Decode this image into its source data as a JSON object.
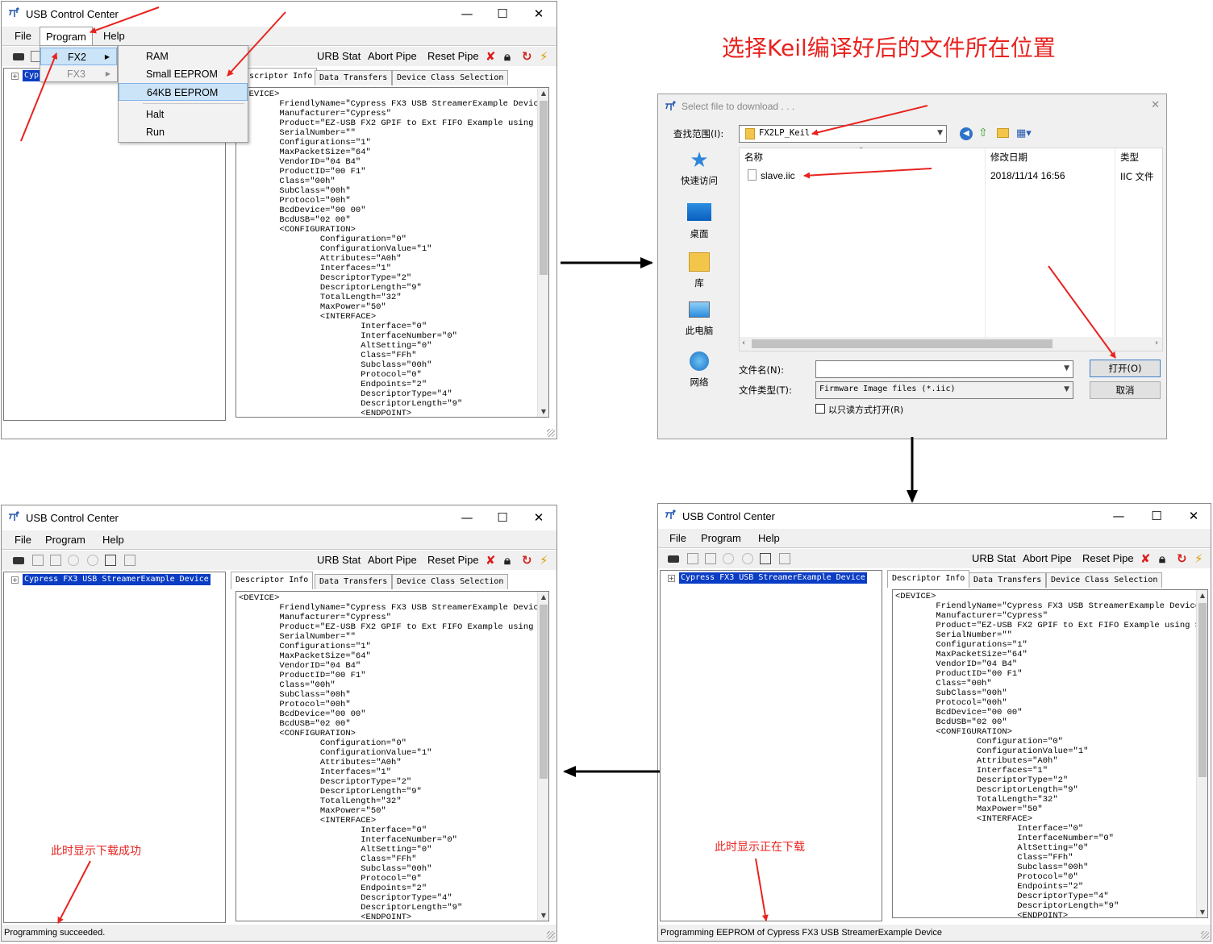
{
  "heading": "选择Keil编译好后的文件所在位置",
  "app_title": "USB Control Center",
  "window_controls": {
    "minimize": "—",
    "maximize": "☐",
    "close": "✕"
  },
  "menu": {
    "file": "File",
    "program": "Program",
    "help": "Help"
  },
  "toolbar": {
    "urb_stat": "URB Stat",
    "abort_pipe": "Abort Pipe",
    "reset_pipe": "Reset Pipe"
  },
  "tabs": {
    "descriptor_info": "Descriptor Info",
    "descriptor_info_clipped": "scriptor Info",
    "data_transfers": "Data Transfers",
    "device_class_selection": "Device Class Selection"
  },
  "tree": {
    "device": "Cypress FX3 USB StreamerExample Device",
    "device_clipped": "Cyp"
  },
  "descriptor_text": "<DEVICE>\n        FriendlyName=\"Cypress FX3 USB StreamerExample Device\"\n        Manufacturer=\"Cypress\"\n        Product=\"EZ-USB FX2 GPIF to Ext FIFO Example using Sir\n        SerialNumber=\"\"\n        Configurations=\"1\"\n        MaxPacketSize=\"64\"\n        VendorID=\"04 B4\"\n        ProductID=\"00 F1\"\n        Class=\"00h\"\n        SubClass=\"00h\"\n        Protocol=\"00h\"\n        BcdDevice=\"00 00\"\n        BcdUSB=\"02 00\"\n        <CONFIGURATION>\n                Configuration=\"0\"\n                ConfigurationValue=\"1\"\n                Attributes=\"A0h\"\n                Interfaces=\"1\"\n                DescriptorType=\"2\"\n                DescriptorLength=\"9\"\n                TotalLength=\"32\"\n                MaxPower=\"50\"\n                <INTERFACE>\n                        Interface=\"0\"\n                        InterfaceNumber=\"0\"\n                        AltSetting=\"0\"\n                        Class=\"FFh\"\n                        Subclass=\"00h\"\n                        Protocol=\"0\"\n                        Endpoints=\"2\"\n                        DescriptorType=\"4\"\n                        DescriptorLength=\"9\"\n                        <ENDPOINT>",
  "program_menu": {
    "fx2": "FX2",
    "fx3": "FX3"
  },
  "fx2_submenu": {
    "ram": "RAM",
    "small_eeprom": "Small EEPROM",
    "eeprom_64kb": "64KB EEPROM",
    "halt": "Halt",
    "run": "Run"
  },
  "dialog": {
    "title": "Select file to download . . .",
    "look_in_label": "查找范围(I):",
    "look_in_value": "FX2LP_Keil",
    "sidebar": [
      "快速访问",
      "桌面",
      "库",
      "此电脑",
      "网络"
    ],
    "columns": {
      "name": "名称",
      "modified": "修改日期",
      "type": "类型"
    },
    "file": {
      "name": "slave.iic",
      "modified": "2018/11/14 16:56",
      "type": "IIC 文件"
    },
    "filename_label": "文件名(N):",
    "filetype_label": "文件类型(T):",
    "filetype_value": "Firmware Image files (*.iic)",
    "readonly_label": "以只读方式打开(R)",
    "open_button": "打开(O)",
    "cancel_button": "取消"
  },
  "status": {
    "downloading": "Programming EEPROM of Cypress FX3 USB StreamerExample Device",
    "succeeded": "Programming succeeded."
  },
  "annotations": {
    "downloading": "此时显示正在下载",
    "succeeded": "此时显示下载成功"
  },
  "colors": {
    "annotation": "#e8231f",
    "selection": "#0a3cc4",
    "menu_highlight": "#cce4f7"
  }
}
